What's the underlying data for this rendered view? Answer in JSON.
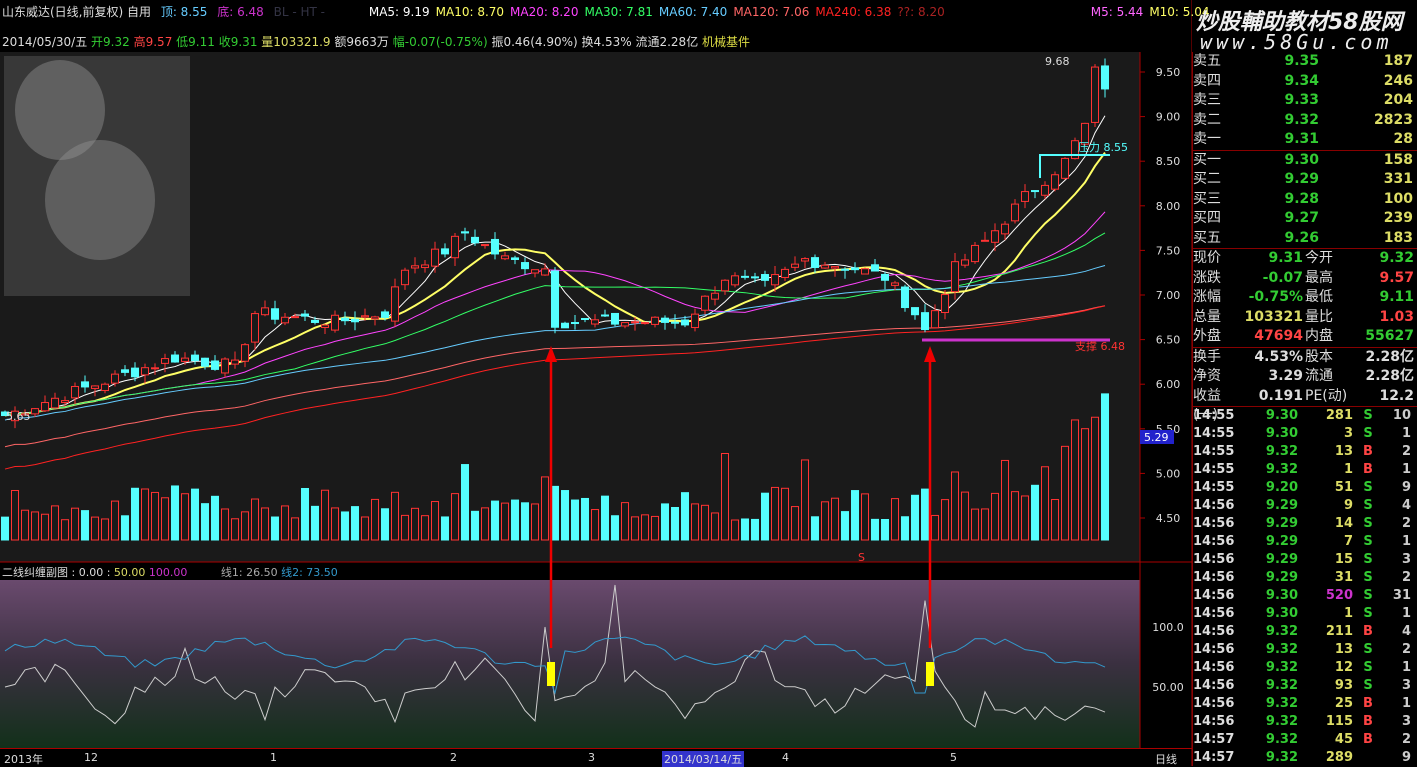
{
  "header": {
    "title": "山东威达(日线,前复权) 自用",
    "top_label": "顶: 8.55",
    "bottom_label": "底: 6.48",
    "bl": "BL - HT -",
    "ma": [
      {
        "t": "MA5: 9.19",
        "c": "#ffffff"
      },
      {
        "t": "MA10: 8.70",
        "c": "#ffff66"
      },
      {
        "t": "MA20: 8.20",
        "c": "#ff44ff"
      },
      {
        "t": "MA30: 7.81",
        "c": "#33ff66"
      },
      {
        "t": "MA60: 7.40",
        "c": "#66ccff"
      },
      {
        "t": "MA120: 7.06",
        "c": "#ff6666"
      },
      {
        "t": "MA240: 6.38",
        "c": "#ff2222"
      },
      {
        "t": "??: 8.20",
        "c": "#aa2222"
      }
    ],
    "vol_ma": [
      {
        "t": "M5: 5.44",
        "c": "#ff66ff"
      },
      {
        "t": "M10: 5.04",
        "c": "#ffff66"
      }
    ]
  },
  "info": {
    "date": "2014/05/30/五",
    "open": "开9.32",
    "high": "高9.57",
    "low": "低9.11",
    "close": "收9.31",
    "volume": "量103321.9",
    "amount": "额9663万",
    "change": "幅-0.07(-0.75%)",
    "amplitude": "振0.46(4.90%)",
    "turnover": "换4.53%",
    "float": "流通2.28亿",
    "sector": "机械基件"
  },
  "logo": {
    "text": "炒股輔助教材58股网",
    "url_text": "www.58Gu.com"
  },
  "price_axis": [
    "9.50",
    "9.00",
    "8.50",
    "8.00",
    "7.50",
    "7.00",
    "6.50",
    "6.00",
    "5.50",
    "5.00",
    "4.50"
  ],
  "vol_axis_badge": "5.29",
  "annotations": {
    "high": "9.68",
    "pressure": "压力 8.55",
    "support": "支撑 6.48",
    "low": "5.65",
    "marker": "S"
  },
  "indicator": {
    "title": "二线纠缠副图 : 0.00 : ",
    "v50": "50.00",
    "v100": "100.00",
    "line1": "线1: 26.50",
    "line2": "线2: 73.50",
    "axis": [
      "100.0",
      "50.00"
    ]
  },
  "time_axis": {
    "labels": [
      "2013年",
      "12",
      "1",
      "2",
      "3",
      "2014/03/14/五",
      "4",
      "5"
    ],
    "period": "日线"
  },
  "order_book": {
    "sell": [
      {
        "l": "卖五",
        "p": "9.35",
        "v": "187"
      },
      {
        "l": "卖四",
        "p": "9.34",
        "v": "246"
      },
      {
        "l": "卖三",
        "p": "9.33",
        "v": "204"
      },
      {
        "l": "卖二",
        "p": "9.32",
        "v": "2823"
      },
      {
        "l": "卖一",
        "p": "9.31",
        "v": "28"
      }
    ],
    "buy": [
      {
        "l": "买一",
        "p": "9.30",
        "v": "158"
      },
      {
        "l": "买二",
        "p": "9.29",
        "v": "331"
      },
      {
        "l": "买三",
        "p": "9.28",
        "v": "100"
      },
      {
        "l": "买四",
        "p": "9.27",
        "v": "239"
      },
      {
        "l": "买五",
        "p": "9.26",
        "v": "183"
      }
    ]
  },
  "quote": [
    {
      "a": "现价",
      "b": "9.31",
      "bc": "#33cc33",
      "c": "今开",
      "d": "9.32",
      "dc": "#33cc33"
    },
    {
      "a": "涨跌",
      "b": "-0.07",
      "bc": "#33cc33",
      "c": "最高",
      "d": "9.57",
      "dc": "#ff4444"
    },
    {
      "a": "涨幅",
      "b": "-0.75%",
      "bc": "#33cc33",
      "c": "最低",
      "d": "9.11",
      "dc": "#33cc33"
    },
    {
      "a": "总量",
      "b": "103321",
      "bc": "#dddd66",
      "c": "量比",
      "d": "1.03",
      "dc": "#ff4444"
    },
    {
      "a": "外盘",
      "b": "47694",
      "bc": "#ff4444",
      "c": "内盘",
      "d": "55627",
      "dc": "#33cc33"
    }
  ],
  "fundamentals": [
    {
      "a": "换手",
      "b": "4.53%",
      "c": "股本",
      "d": "2.28亿"
    },
    {
      "a": "净资",
      "b": "3.29",
      "c": "流通",
      "d": "2.28亿"
    },
    {
      "a": "收益(一)",
      "b": "0.191",
      "c": "PE(动)",
      "d": "12.2"
    }
  ],
  "ticks": [
    [
      "14:55",
      "9.30",
      "281",
      "S",
      "10"
    ],
    [
      "14:55",
      "9.30",
      "3",
      "S",
      "1"
    ],
    [
      "14:55",
      "9.32",
      "13",
      "B",
      "2"
    ],
    [
      "14:55",
      "9.32",
      "1",
      "B",
      "1"
    ],
    [
      "14:55",
      "9.20",
      "51",
      "S",
      "9"
    ],
    [
      "14:56",
      "9.29",
      "9",
      "S",
      "4"
    ],
    [
      "14:56",
      "9.29",
      "14",
      "S",
      "2"
    ],
    [
      "14:56",
      "9.29",
      "7",
      "S",
      "1"
    ],
    [
      "14:56",
      "9.29",
      "15",
      "S",
      "3"
    ],
    [
      "14:56",
      "9.29",
      "31",
      "S",
      "2"
    ],
    [
      "14:56",
      "9.30",
      "520",
      "S",
      "31"
    ],
    [
      "14:56",
      "9.30",
      "1",
      "S",
      "1"
    ],
    [
      "14:56",
      "9.32",
      "211",
      "B",
      "4"
    ],
    [
      "14:56",
      "9.32",
      "13",
      "S",
      "2"
    ],
    [
      "14:56",
      "9.32",
      "12",
      "S",
      "1"
    ],
    [
      "14:56",
      "9.32",
      "93",
      "S",
      "3"
    ],
    [
      "14:56",
      "9.32",
      "25",
      "B",
      "1"
    ],
    [
      "14:56",
      "9.32",
      "115",
      "B",
      "3"
    ],
    [
      "14:57",
      "9.32",
      "45",
      "B",
      "2"
    ],
    [
      "14:57",
      "9.32",
      "289",
      "",
      "9"
    ]
  ],
  "chart_data": {
    "type": "candlestick",
    "price_range": [
      4.3,
      9.75
    ],
    "close_keypoints": [
      [
        0,
        5.65
      ],
      [
        17,
        6.3
      ],
      [
        23,
        6.2
      ],
      [
        25,
        6.8
      ],
      [
        33,
        6.7
      ],
      [
        38,
        6.8
      ],
      [
        40,
        7.3
      ],
      [
        44,
        7.5
      ],
      [
        46,
        7.7
      ],
      [
        50,
        7.4
      ],
      [
        54,
        7.3
      ],
      [
        55,
        6.7
      ],
      [
        60,
        6.7
      ],
      [
        68,
        6.7
      ],
      [
        72,
        7.2
      ],
      [
        76,
        7.1
      ],
      [
        80,
        7.4
      ],
      [
        85,
        7.3
      ],
      [
        88,
        7.2
      ],
      [
        91,
        6.8
      ],
      [
        92,
        6.6
      ],
      [
        95,
        7.3
      ],
      [
        98,
        7.6
      ],
      [
        102,
        8.1
      ],
      [
        106,
        8.5
      ],
      [
        108,
        8.9
      ],
      [
        109,
        9.5
      ],
      [
        110,
        9.31
      ]
    ]
  }
}
